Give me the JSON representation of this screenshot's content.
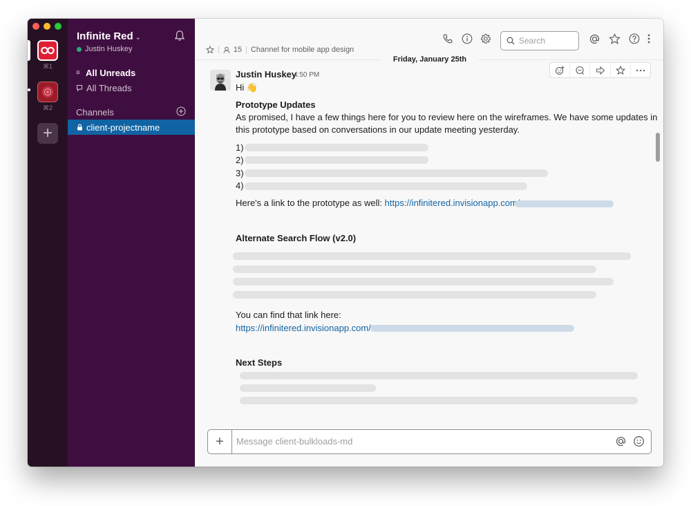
{
  "workspaces": [
    {
      "name": "Infinite Red",
      "shortcut": "⌘1",
      "icon": "infinite-red-logo-icon"
    },
    {
      "name": "",
      "shortcut": "⌘2",
      "icon": "workspace-avatar-icon"
    }
  ],
  "sidebar": {
    "team_name": "Infinite Red",
    "user_name": "Justin Huskey",
    "all_unreads": "All Unreads",
    "all_threads": "All Threads",
    "channels_header": "Channels",
    "selected_channel": "client-projectname"
  },
  "header": {
    "member_count": "15",
    "topic": "Channel for mobile app design",
    "search_placeholder": "Search"
  },
  "message": {
    "date_divider": "Friday, January 25th",
    "author": "Justin Huskey",
    "time": "4:50 PM",
    "greeting": "Hi 👋",
    "section1_title": "Prototype Updates",
    "section1_line1": "As promised, I have a few things here for you to review here on the wireframes. We have some updates in",
    "section1_line2": "this prototype based on conversations in our update meeting yesterday.",
    "list_numbers": [
      "1)",
      "2)",
      "3)",
      "4)"
    ],
    "link_intro": "Here's a link to the prototype as well:",
    "link1": "https://infinitered.invisionapp.com/",
    "section2_title": "Alternate Search Flow (v2.0)",
    "find_link_text": "You can find that link here:",
    "link2": "https://infinitered.invisionapp.com/",
    "section3_title": "Next Steps"
  },
  "composer": {
    "placeholder": "Message client-bulkloads-md"
  },
  "colors": {
    "sidebar_bg": "#3f0e40",
    "rail_bg": "#261124",
    "selected_channel_bg": "#1164a3",
    "link": "#1264a3",
    "presence_active": "#2bac76"
  }
}
